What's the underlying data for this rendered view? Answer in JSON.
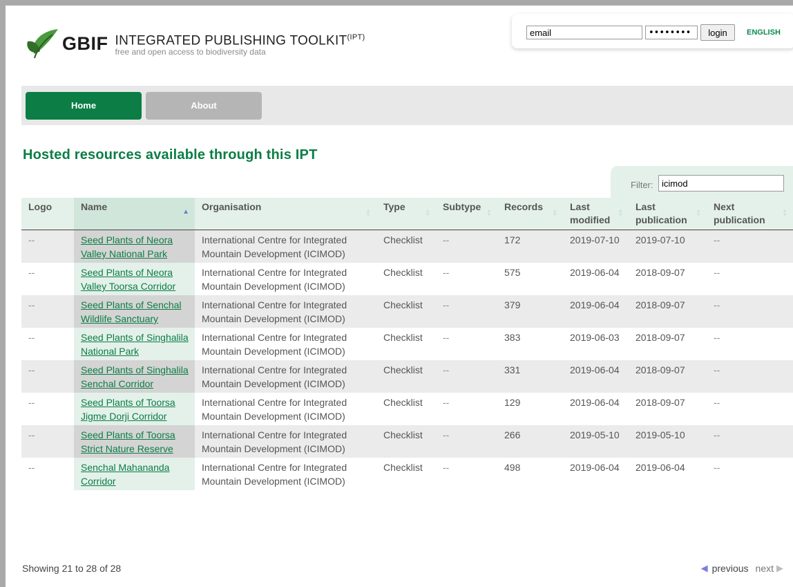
{
  "header": {
    "brand": "GBIF",
    "title": "INTEGRATED PUBLISHING TOOLKIT",
    "title_sup": "(IPT)",
    "subtitle": "free and open access to biodiversity data"
  },
  "login": {
    "email_value": "email",
    "password_value": "••••••••",
    "login_label": "login",
    "language": "ENGLISH"
  },
  "nav": {
    "home": "Home",
    "about": "About"
  },
  "main": {
    "title": "Hosted resources available through this IPT",
    "filter_label": "Filter:",
    "filter_value": "icimod"
  },
  "table": {
    "columns": [
      "Logo",
      "Name",
      "Organisation",
      "Type",
      "Subtype",
      "Records",
      "Last modified",
      "Last publication",
      "Next publication"
    ],
    "rows": [
      {
        "logo": "--",
        "name": "Seed Plants of Neora Valley National Park",
        "organisation": "International Centre for Integrated Mountain Development (ICIMOD)",
        "type": "Checklist",
        "subtype": "--",
        "records": "172",
        "last_modified": "2019-07-10",
        "last_publication": "2019-07-10",
        "next_publication": "--"
      },
      {
        "logo": "--",
        "name": "Seed Plants of Neora Valley Toorsa Corridor",
        "organisation": "International Centre for Integrated Mountain Development (ICIMOD)",
        "type": "Checklist",
        "subtype": "--",
        "records": "575",
        "last_modified": "2019-06-04",
        "last_publication": "2018-09-07",
        "next_publication": "--"
      },
      {
        "logo": "--",
        "name": "Seed Plants of Senchal Wildlife Sanctuary",
        "organisation": "International Centre for Integrated Mountain Development (ICIMOD)",
        "type": "Checklist",
        "subtype": "--",
        "records": "379",
        "last_modified": "2019-06-04",
        "last_publication": "2018-09-07",
        "next_publication": "--"
      },
      {
        "logo": "--",
        "name": "Seed Plants of Singhalila National Park",
        "organisation": "International Centre for Integrated Mountain Development (ICIMOD)",
        "type": "Checklist",
        "subtype": "--",
        "records": "383",
        "last_modified": "2019-06-03",
        "last_publication": "2018-09-07",
        "next_publication": "--"
      },
      {
        "logo": "--",
        "name": "Seed Plants of Singhalila Senchal Corridor",
        "organisation": "International Centre for Integrated Mountain Development (ICIMOD)",
        "type": "Checklist",
        "subtype": "--",
        "records": "331",
        "last_modified": "2019-06-04",
        "last_publication": "2018-09-07",
        "next_publication": "--"
      },
      {
        "logo": "--",
        "name": "Seed Plants of Toorsa Jigme Dorji Corridor",
        "organisation": "International Centre for Integrated Mountain Development (ICIMOD)",
        "type": "Checklist",
        "subtype": "--",
        "records": "129",
        "last_modified": "2019-06-04",
        "last_publication": "2018-09-07",
        "next_publication": "--"
      },
      {
        "logo": "--",
        "name": "Seed Plants of Toorsa Strict Nature Reserve",
        "organisation": "International Centre for Integrated Mountain Development (ICIMOD)",
        "type": "Checklist",
        "subtype": "--",
        "records": "266",
        "last_modified": "2019-05-10",
        "last_publication": "2019-05-10",
        "next_publication": "--"
      },
      {
        "logo": "--",
        "name": "Senchal Mahananda Corridor",
        "organisation": "International Centre for Integrated Mountain Development (ICIMOD)",
        "type": "Checklist",
        "subtype": "--",
        "records": "498",
        "last_modified": "2019-06-04",
        "last_publication": "2019-06-04",
        "next_publication": "--"
      }
    ]
  },
  "footer": {
    "info": "Showing 21 to 28 of 28",
    "previous": "previous",
    "next": "next"
  },
  "colors": {
    "brand_green": "#0b7d45",
    "header_row_bg": "#e4f1ea",
    "nav_inactive": "#b5b5b5"
  },
  "icons": [
    "leaf-logo-icon",
    "sort-asc-icon",
    "sort-both-icon",
    "previous-arrow-icon",
    "next-arrow-icon"
  ]
}
